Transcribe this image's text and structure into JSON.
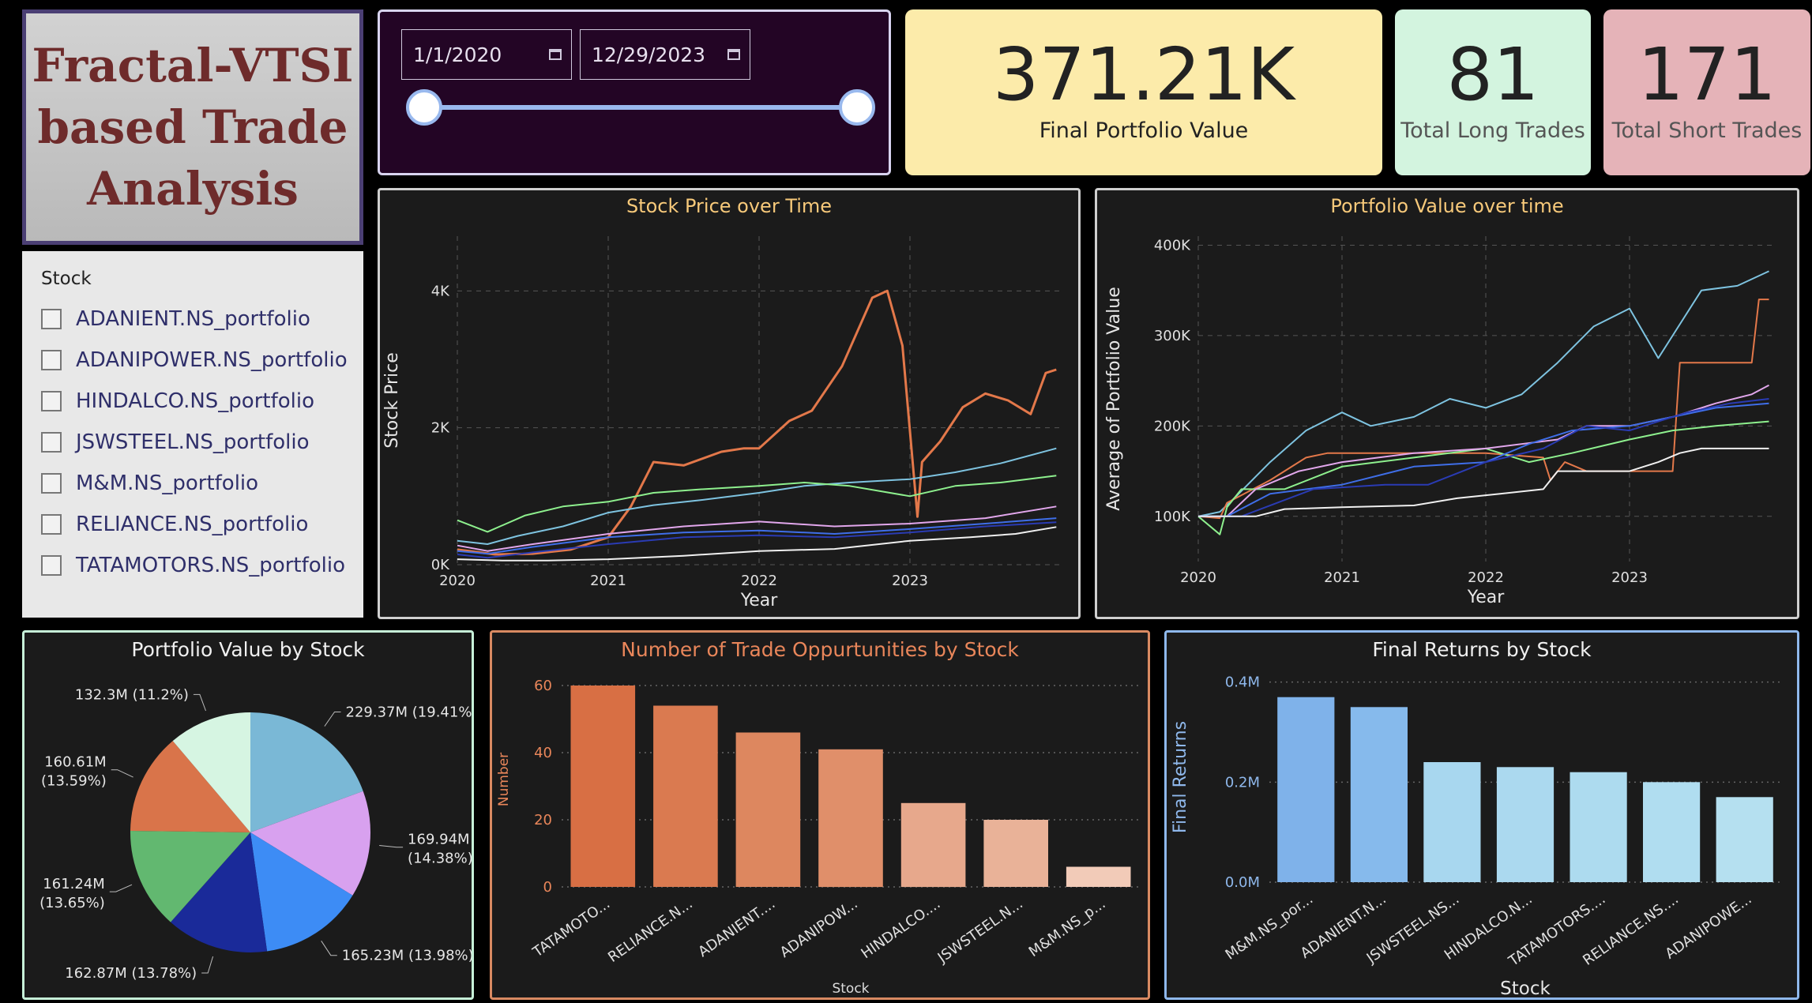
{
  "title": {
    "line1": "Fractal-VTSI",
    "line2": "based Trade",
    "line3": "Analysis"
  },
  "slicer": {
    "header": "Stock",
    "items": [
      "ADANIENT.NS_portfolio",
      "ADANIPOWER.NS_portfolio",
      "HINDALCO.NS_portfolio",
      "JSWSTEEL.NS_portfolio",
      "M&M.NS_portfolio",
      "RELIANCE.NS_portfolio",
      "TATAMOTORS.NS_portfolio"
    ]
  },
  "date_filter": {
    "start": "1/1/2020",
    "end": "12/29/2023"
  },
  "kpis": {
    "final_portfolio_value": {
      "value": "371.21K",
      "label": "Final Portfolio Value"
    },
    "total_long_trades": {
      "value": "81",
      "label": "Total Long Trades"
    },
    "total_short_trades": {
      "value": "171",
      "label": "Total Short Trades"
    }
  },
  "colors": {
    "panel_bg": "#1b1b1b",
    "title_gold": "#f7c97a",
    "trade_title": "#e9865a",
    "grid": "#555555"
  },
  "chart_data": [
    {
      "id": "stock_price",
      "type": "line",
      "title": "Stock Price over Time",
      "xlabel": "Year",
      "ylabel": "Stock Price",
      "x_ticks": [
        "2020",
        "2021",
        "2022",
        "2023"
      ],
      "y_ticks": [
        "0K",
        "2K",
        "4K"
      ],
      "xlim": [
        2020.0,
        2024.0
      ],
      "ylim": [
        0,
        4800
      ],
      "grid": true,
      "series": [
        {
          "color": "#e3784a",
          "x": [
            2020.0,
            2020.25,
            2020.5,
            2020.75,
            2021.0,
            2021.15,
            2021.3,
            2021.5,
            2021.75,
            2021.9,
            2022.0,
            2022.2,
            2022.35,
            2022.55,
            2022.75,
            2022.85,
            2022.95,
            2023.05,
            2023.08,
            2023.2,
            2023.35,
            2023.5,
            2023.65,
            2023.8,
            2023.9,
            2023.97
          ],
          "y": [
            220,
            150,
            160,
            220,
            400,
            850,
            1500,
            1450,
            1650,
            1700,
            1700,
            2100,
            2250,
            2900,
            3900,
            4000,
            3200,
            700,
            1500,
            1800,
            2300,
            2500,
            2400,
            2200,
            2800,
            2850
          ]
        },
        {
          "color": "#7ec3e0",
          "x": [
            2020.0,
            2020.2,
            2020.4,
            2020.7,
            2021.0,
            2021.3,
            2021.6,
            2022.0,
            2022.3,
            2022.6,
            2023.0,
            2023.3,
            2023.6,
            2023.97
          ],
          "y": [
            350,
            300,
            420,
            560,
            760,
            870,
            940,
            1050,
            1150,
            1200,
            1250,
            1350,
            1480,
            1700
          ]
        },
        {
          "color": "#8ef08e",
          "x": [
            2020.0,
            2020.2,
            2020.45,
            2020.7,
            2021.0,
            2021.3,
            2021.6,
            2022.0,
            2022.3,
            2022.6,
            2023.0,
            2023.3,
            2023.6,
            2023.97
          ],
          "y": [
            650,
            480,
            720,
            850,
            920,
            1050,
            1100,
            1150,
            1200,
            1150,
            1000,
            1150,
            1200,
            1300
          ]
        },
        {
          "color": "#e2a7ec",
          "x": [
            2020.0,
            2020.2,
            2020.5,
            2021.0,
            2021.5,
            2022.0,
            2022.5,
            2023.0,
            2023.5,
            2023.97
          ],
          "y": [
            280,
            200,
            300,
            450,
            560,
            630,
            560,
            600,
            680,
            850
          ]
        },
        {
          "color": "#3f6ee8",
          "x": [
            2020.0,
            2020.2,
            2020.5,
            2021.0,
            2021.5,
            2022.0,
            2022.5,
            2023.0,
            2023.5,
            2023.97
          ],
          "y": [
            200,
            160,
            260,
            400,
            470,
            500,
            450,
            520,
            600,
            680
          ]
        },
        {
          "color": "#2a3bb3",
          "x": [
            2020.0,
            2020.2,
            2020.5,
            2021.0,
            2021.5,
            2022.0,
            2022.5,
            2023.0,
            2023.5,
            2023.97
          ],
          "y": [
            150,
            100,
            180,
            300,
            400,
            430,
            400,
            470,
            560,
            620
          ]
        },
        {
          "color": "#f0f0f0",
          "x": [
            2020.0,
            2020.3,
            2020.6,
            2021.0,
            2021.5,
            2022.0,
            2022.5,
            2023.0,
            2023.4,
            2023.7,
            2023.97
          ],
          "y": [
            80,
            60,
            60,
            80,
            130,
            200,
            230,
            350,
            400,
            450,
            550
          ]
        }
      ]
    },
    {
      "id": "portfolio_value",
      "type": "line",
      "title": "Portfolio Value over time",
      "xlabel": "Year",
      "ylabel": "Average of Portfolio Value",
      "x_ticks": [
        "2020",
        "2021",
        "2022",
        "2023"
      ],
      "y_ticks": [
        "100K",
        "200K",
        "300K",
        "400K"
      ],
      "xlim": [
        2020.0,
        2024.0
      ],
      "ylim": [
        50000,
        410000
      ],
      "grid": true,
      "series": [
        {
          "color": "#7ec3e0",
          "x": [
            2020.0,
            2020.15,
            2020.25,
            2020.5,
            2020.75,
            2021.0,
            2021.2,
            2021.5,
            2021.75,
            2022.0,
            2022.25,
            2022.5,
            2022.75,
            2023.0,
            2023.2,
            2023.3,
            2023.5,
            2023.75,
            2023.97
          ],
          "y": [
            100000,
            105000,
            120000,
            160000,
            195000,
            215000,
            200000,
            210000,
            230000,
            220000,
            235000,
            270000,
            310000,
            330000,
            275000,
            300000,
            350000,
            355000,
            371210
          ]
        },
        {
          "color": "#e3784a",
          "x": [
            2020.0,
            2020.15,
            2020.2,
            2020.5,
            2020.75,
            2020.9,
            2021.2,
            2022.0,
            2022.4,
            2022.45,
            2022.55,
            2022.7,
            2023.3,
            2023.35,
            2023.85,
            2023.9,
            2023.97
          ],
          "y": [
            100000,
            98000,
            115000,
            140000,
            165000,
            170000,
            170000,
            170000,
            165000,
            140000,
            160000,
            150000,
            150000,
            270000,
            270000,
            340000,
            340000
          ]
        },
        {
          "color": "#8ef08e",
          "x": [
            2020.0,
            2020.15,
            2020.2,
            2020.3,
            2020.6,
            2021.0,
            2021.5,
            2022.0,
            2022.3,
            2022.6,
            2023.0,
            2023.3,
            2023.6,
            2023.97
          ],
          "y": [
            100000,
            80000,
            110000,
            130000,
            130000,
            155000,
            165000,
            175000,
            160000,
            170000,
            185000,
            195000,
            200000,
            205000
          ]
        },
        {
          "color": "#e2a7ec",
          "x": [
            2020.0,
            2020.2,
            2020.4,
            2020.7,
            2021.0,
            2021.5,
            2022.0,
            2022.5,
            2022.7,
            2023.0,
            2023.3,
            2023.6,
            2023.85,
            2023.97
          ],
          "y": [
            100000,
            100000,
            130000,
            150000,
            160000,
            170000,
            175000,
            185000,
            200000,
            200000,
            210000,
            225000,
            235000,
            245000
          ]
        },
        {
          "color": "#3f6ee8",
          "x": [
            2020.0,
            2020.2,
            2020.5,
            2021.0,
            2021.5,
            2022.0,
            2022.3,
            2022.6,
            2023.0,
            2023.3,
            2023.6,
            2023.97
          ],
          "y": [
            100000,
            100000,
            125000,
            135000,
            155000,
            160000,
            180000,
            195000,
            200000,
            210000,
            220000,
            225000
          ]
        },
        {
          "color": "#2a3bb3",
          "x": [
            2020.0,
            2020.3,
            2020.8,
            2021.3,
            2021.6,
            2022.0,
            2022.4,
            2022.7,
            2023.0,
            2023.4,
            2023.7,
            2023.97
          ],
          "y": [
            100000,
            100000,
            130000,
            135000,
            135000,
            160000,
            175000,
            200000,
            195000,
            215000,
            225000,
            230000
          ]
        },
        {
          "color": "#f0f0f0",
          "x": [
            2020.0,
            2020.4,
            2020.6,
            2021.0,
            2021.5,
            2021.8,
            2022.1,
            2022.4,
            2022.5,
            2023.0,
            2023.2,
            2023.35,
            2023.5,
            2023.97
          ],
          "y": [
            100000,
            100000,
            108000,
            110000,
            112000,
            120000,
            125000,
            130000,
            150000,
            150000,
            160000,
            170000,
            175000,
            175000
          ]
        }
      ]
    },
    {
      "id": "portfolio_by_stock",
      "type": "pie",
      "title": "Portfolio Value by Stock",
      "start_angle_deg": 0,
      "slices": [
        {
          "value": 229.37,
          "label": "229.37M (19.41%)",
          "color": "#7ab8d6"
        },
        {
          "value": 169.94,
          "label": "169.94M (14.38%)",
          "color": "#d8a1ef"
        },
        {
          "value": 165.23,
          "label": "165.23M (13.98%)",
          "color": "#3d8cf5"
        },
        {
          "value": 162.87,
          "label": "162.87M (13.78%)",
          "color": "#1a2a99"
        },
        {
          "value": 161.24,
          "label": "161.24M (13.65%)",
          "color": "#62b870"
        },
        {
          "value": 160.61,
          "label": "160.61M (13.59%)",
          "color": "#d9744a"
        },
        {
          "value": 132.3,
          "label": "132.3M (11.2%)",
          "color": "#d6f5e2"
        }
      ]
    },
    {
      "id": "trade_opportunities",
      "type": "bar",
      "title": "Number of Trade Oppurtunities by Stock",
      "xlabel": "Stock",
      "ylabel": "Number",
      "categories": [
        "TATAMOTO...",
        "RELIANCE.N...",
        "ADANIENT....",
        "ADANIPOW...",
        "HINDALCO....",
        "JSWSTEEL.N...",
        "M&M.NS_p..."
      ],
      "values": [
        60,
        54,
        46,
        41,
        25,
        20,
        6
      ],
      "colors": [
        "#d86f44",
        "#da7a50",
        "#dd875f",
        "#e08f6a",
        "#e7a88c",
        "#e9b298",
        "#f2cbb8"
      ],
      "ylim": [
        0,
        64
      ],
      "y_ticks": [
        "0",
        "20",
        "40",
        "60"
      ]
    },
    {
      "id": "final_returns",
      "type": "bar",
      "title": "Final Returns by Stock",
      "xlabel": "Stock",
      "ylabel": "Final Returns",
      "categories": [
        "M&M.NS_por...",
        "ADANIENT.N...",
        "JSWSTEEL.NS...",
        "HINDALCO.N...",
        "TATAMOTORS....",
        "RELIANCE.NS....",
        "ADANIPOWE..."
      ],
      "values": [
        0.37,
        0.35,
        0.24,
        0.23,
        0.22,
        0.2,
        0.17
      ],
      "colors": [
        "#7fb2ea",
        "#86baec",
        "#a8d7ef",
        "#abd9ef",
        "#addbef",
        "#b0ddf0",
        "#b5e0f0"
      ],
      "ylim": [
        0,
        0.42
      ],
      "y_ticks": [
        "0.0M",
        "0.2M",
        "0.4M"
      ]
    }
  ]
}
